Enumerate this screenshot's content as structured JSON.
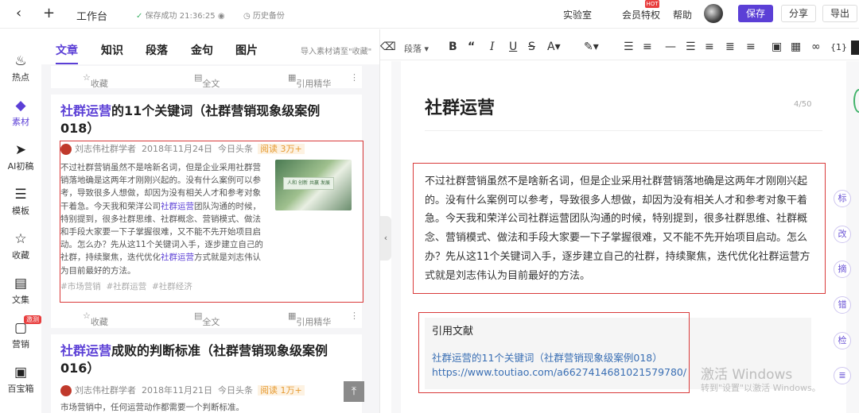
{
  "topbar": {
    "workbench": "工作台",
    "save_status": "保存成功 21:36:25",
    "history": "历史备份",
    "lab": "实验室",
    "member": "会员特权",
    "hot": "HOT",
    "help": "帮助",
    "save": "保存",
    "share": "分享",
    "exit": "导出"
  },
  "sidebar": {
    "items": [
      {
        "label": "热点",
        "icon": "flame-icon"
      },
      {
        "label": "素材",
        "icon": "layers-icon"
      },
      {
        "label": "AI初稿",
        "icon": "rocket-icon"
      },
      {
        "label": "模板",
        "icon": "document-icon"
      },
      {
        "label": "收藏",
        "icon": "star-icon"
      },
      {
        "label": "文集",
        "icon": "book-icon"
      },
      {
        "label": "营销",
        "icon": "tag-icon",
        "badge": "邀测"
      },
      {
        "label": "百宝箱",
        "icon": "toolbox-icon"
      }
    ]
  },
  "material": {
    "tabs": [
      "文章",
      "知识",
      "段落",
      "金句",
      "图片"
    ],
    "hint": "导入素材请至\"收藏\"",
    "actions": {
      "favorite": "收藏",
      "fulltext": "全文",
      "quote": "引用精华"
    },
    "articles": [
      {
        "title_highlight": "社群运营",
        "title_rest": "的11个关键词（社群营销现象级案例018）",
        "author": "刘志伟社群学者",
        "date": "2018年11月24日",
        "source": "今日头条",
        "reads": "阅读 3万+",
        "body_a": "不过社群营销虽然不是啥新名词，但是企业采用社群营销落地确是这两年才刚刚兴起的。没有什么案例可以参考，导致很多人想做，却因为没有相关人才和参考对象干着急。今天我和荣洋公司",
        "body_link1": "社群运营",
        "body_b": "团队沟通的时候，特别提到，很多社群思维、社群概念、营销模式、做法和手段大家要一下子掌握很难，又不能不先开始项目启动。怎么办？先从这11个关键词入手，逐步建立自己的社群，持续聚焦，迭代优化",
        "body_link2": "社群运营",
        "body_c": "方式就是刘志伟认为目前最好的方法。",
        "thumb_text": "人和 创新 共赢 发展",
        "tags": [
          "#市场营销",
          "#社群运营",
          "#社群经济"
        ]
      },
      {
        "title_highlight": "社群运营",
        "title_rest": "成败的判断标准（社群营销现象级案例016）",
        "author": "刘志伟社群学者",
        "date": "2018年11月21日",
        "source": "今日头条",
        "reads": "阅读 1万+",
        "body": "市场营销中，任何运营动作都需要一个判断标准。"
      }
    ]
  },
  "toolbar": {
    "paragraph": "段落"
  },
  "document": {
    "title": "社群运营",
    "count": "4/50",
    "paragraph": "不过社群营销虽然不是啥新名词，但是企业采用社群营销落地确是这两年才刚刚兴起的。没有什么案例可以参考，导致很多人想做，却因为没有相关人才和参考对象干着急。今天我和荣洋公司社群运营团队沟通的时候，特别提到，很多社群思维、社群概念、营销模式、做法和手段大家要一下子掌握很难，又不能不先开始项目启动。怎么办？先从这11个关键词入手，逐步建立自己的社群，持续聚焦，迭代优化社群运营方式就是刘志伟认为目前最好的方法。",
    "quote_heading": "引用文献",
    "quote_title": "社群运营的11个关键词（社群营销现象级案例018）",
    "quote_url": "https://www.toutiao.com/a6627414681021579780/"
  },
  "right_tools": [
    "标",
    "改",
    "摘",
    "错",
    "检",
    "≣"
  ],
  "watermark": {
    "line1": "激活 Windows",
    "line2": "转到\"设置\"以激活 Windows。"
  },
  "colors": {
    "accent": "#5b3fd6",
    "highlight_box": "#d93a3a",
    "link": "#3a6fb4"
  }
}
